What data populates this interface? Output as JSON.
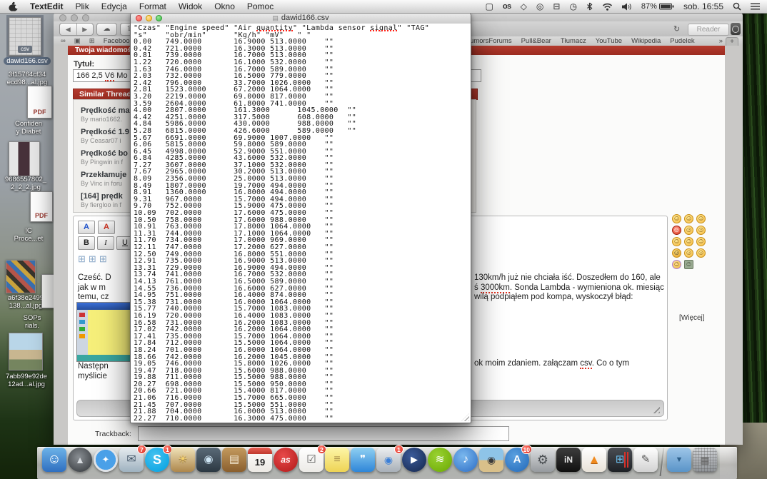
{
  "menu_bar": {
    "app_name": "TextEdit",
    "menus": [
      "Plik",
      "Edycja",
      "Format",
      "Widok",
      "Okno",
      "Pomoc"
    ],
    "status_icons": [
      {
        "name": "app-shape-icon",
        "glyph": "▢"
      },
      {
        "name": "lastfm-status-icon",
        "glyph": "os"
      },
      {
        "name": "dropbox-icon",
        "glyph": "◇"
      },
      {
        "name": "sync-alert-icon",
        "glyph": "◎"
      },
      {
        "name": "disk-icon",
        "glyph": "⊟"
      },
      {
        "name": "time-machine-icon",
        "glyph": "◷"
      }
    ],
    "battery": "87%",
    "clock": "sob. 16:55"
  },
  "desktop": {
    "icons": [
      {
        "name": "dawid166-csv",
        "kind": "csv",
        "badge": "csv",
        "selected": true,
        "lines": [
          "dawid166.csv"
        ],
        "thumb": [
          12,
          6,
          44,
          52
        ],
        "label": [
          0,
          62,
          76
        ]
      },
      {
        "name": "image-3f15764",
        "kind": "none",
        "selected": false,
        "lines": [
          "3f15764cf34",
          "ecd98...al.jpg"
        ],
        "thumb": null,
        "label": [
          0,
          81,
          76
        ]
      },
      {
        "name": "pdf-confiden",
        "kind": "pdf",
        "badge": "PDF",
        "selected": false,
        "lines": [
          "Confiden",
          "y Diabet"
        ],
        "thumb": [
          38,
          102,
          33,
          44
        ],
        "label": [
          4,
          150,
          72
        ]
      },
      {
        "name": "image-9686557802",
        "kind": "person",
        "selected": false,
        "lines": [
          "9686557802_",
          "2_2_2.jpg"
        ],
        "thumb": [
          12,
          180,
          42,
          47
        ],
        "label": [
          0,
          228,
          72
        ]
      },
      {
        "name": "pdf-ic-proce",
        "kind": "pdf",
        "badge": "PDF",
        "selected": false,
        "lines": [
          "IC",
          "Proce...et"
        ],
        "thumb": [
          42,
          250,
          30,
          41
        ],
        "label": [
          4,
          300,
          72
        ]
      },
      {
        "name": "image-a6f38e2499",
        "kind": "gta",
        "selected": false,
        "lines": [
          "a6f38e2499",
          "138...al.jpg"
        ],
        "thumb": [
          8,
          346,
          40,
          45
        ],
        "label": [
          0,
          394,
          72
        ]
      },
      {
        "name": "doc-sops",
        "kind": "sliver",
        "selected": false,
        "lines": [
          "SOPs",
          "rials."
        ],
        "thumb": [
          58,
          366,
          16,
          46
        ],
        "label": [
          16,
          422,
          58
        ]
      },
      {
        "name": "image-7abb99e92de",
        "kind": "photo",
        "selected": false,
        "lines": [
          "7abb99e92de",
          "12ad...al.jpg"
        ],
        "thumb": [
          12,
          448,
          46,
          51
        ],
        "label": [
          0,
          504,
          74
        ]
      }
    ]
  },
  "safari": {
    "reader_label": "Reader",
    "bookmarks_left": [
      "Facebook"
    ],
    "bookmarks_right": [
      "umorsForums",
      "Pull&Bear",
      "Tłumacz",
      "YouTube",
      "Wikipedia",
      "Pudelek"
    ],
    "chevron": "»",
    "new_tab": "+"
  },
  "forum": {
    "banner": "Twoja wiadomość",
    "title_label": "Tytuł:",
    "title_value": [
      {
        "t": "166 2,5 "
      },
      {
        "t": "V6",
        "mis": true
      },
      {
        "t": " Mo"
      }
    ],
    "similar_header": "Similar Threads",
    "threads": [
      {
        "title": "Prędkość ma",
        "by": "By mario1662."
      },
      {
        "title": "Prędkość 1.9",
        "by": "By Ceasar07 i"
      },
      {
        "title": "Prędkość bo",
        "by": "By Pingwin in f"
      },
      {
        "title": "Przekłamuje",
        "by": "By Vinc in foru"
      },
      {
        "title": "[164] prędk",
        "by": "By fiergloo in f"
      }
    ],
    "editor": {
      "font_btn": "A",
      "color_btn": "A",
      "bold": "B",
      "italic": "I",
      "underline": "U"
    },
    "msg_left": [
      "Cześć. D",
      "jak w m",
      "temu, cz"
    ],
    "msg_left2": [
      "Następn",
      "myślicie"
    ],
    "msg_right": [
      [
        {
          "t": "130km/h już nie chciała iść. Doszedłem do 160, ale"
        }
      ],
      [
        {
          "t": "ś "
        },
        {
          "t": "3000km",
          "mis": true
        },
        {
          "t": ". Sonda Lambda - wymieniona ok. miesiąc"
        }
      ],
      [
        {
          "t": "wilą podpiąłem pod kompa, wyskoczył błąd:"
        }
      ]
    ],
    "msg_right2": [
      [
        {
          "t": "ok moim zdaniem. załączam "
        },
        {
          "t": "csv",
          "mis": true
        },
        {
          "t": ". Co o tym"
        }
      ]
    ],
    "more_link": "[Więcej]",
    "trackback_label": "Trackback:"
  },
  "textedit": {
    "window_title": "dawid166.csv",
    "csv": {
      "header": [
        "\"Czas\"",
        "\"Engine speed\"",
        "\"Air quantity\"",
        "\"Lambda sensor signal\"",
        "\"TAG\""
      ],
      "units": [
        "\"s\"",
        "\"obr/min\"",
        "\"Kg/h\"",
        "\"mV\"",
        "\" \""
      ],
      "tag": "\"\"",
      "rows": [
        [
          "0.00",
          "749.0000",
          "16.9000",
          "513.0000"
        ],
        [
          "0.42",
          "721.0000",
          "16.3000",
          "513.0000"
        ],
        [
          "0.81",
          "739.0000",
          "16.7000",
          "513.0000"
        ],
        [
          "1.22",
          "720.0000",
          "16.1000",
          "532.0000"
        ],
        [
          "1.63",
          "746.0000",
          "16.7000",
          "589.0000"
        ],
        [
          "2.03",
          "732.0000",
          "16.5000",
          "779.0000"
        ],
        [
          "2.42",
          "796.0000",
          "33.7000",
          "1026.0000"
        ],
        [
          "2.81",
          "1523.0000",
          "67.2000",
          "1064.0000"
        ],
        [
          "3.20",
          "2219.0000",
          "69.0000",
          "817.0000"
        ],
        [
          "3.59",
          "2604.0000",
          "61.8000",
          "741.0000"
        ],
        [
          "4.00",
          "2807.0000",
          "161.3000",
          "1045.0000"
        ],
        [
          "4.42",
          "4251.0000",
          "317.5000",
          "608.0000"
        ],
        [
          "4.84",
          "5986.0000",
          "430.0000",
          "988.0000"
        ],
        [
          "5.28",
          "6815.0000",
          "426.6000",
          "589.0000"
        ],
        [
          "5.67",
          "6691.0000",
          "69.9000",
          "1007.0000"
        ],
        [
          "6.06",
          "5815.0000",
          "59.8000",
          "589.0000"
        ],
        [
          "6.45",
          "4998.0000",
          "52.9000",
          "551.0000"
        ],
        [
          "6.84",
          "4285.0000",
          "43.6000",
          "532.0000"
        ],
        [
          "7.27",
          "3607.0000",
          "37.1000",
          "532.0000"
        ],
        [
          "7.67",
          "2965.0000",
          "30.2000",
          "513.0000"
        ],
        [
          "8.09",
          "2356.0000",
          "25.0000",
          "513.0000"
        ],
        [
          "8.49",
          "1807.0000",
          "19.7000",
          "494.0000"
        ],
        [
          "8.91",
          "1360.0000",
          "16.8000",
          "494.0000"
        ],
        [
          "9.31",
          "967.0000",
          "15.7000",
          "494.0000"
        ],
        [
          "9.70",
          "752.0000",
          "15.9000",
          "475.0000"
        ],
        [
          "10.09",
          "702.0000",
          "17.6000",
          "475.0000"
        ],
        [
          "10.50",
          "758.0000",
          "17.6000",
          "988.0000"
        ],
        [
          "10.91",
          "763.0000",
          "17.8000",
          "1064.0000"
        ],
        [
          "11.31",
          "744.0000",
          "17.1000",
          "1064.0000"
        ],
        [
          "11.70",
          "734.0000",
          "17.0000",
          "969.0000"
        ],
        [
          "12.11",
          "747.0000",
          "17.2000",
          "627.0000"
        ],
        [
          "12.50",
          "749.0000",
          "16.8000",
          "551.0000"
        ],
        [
          "12.91",
          "735.0000",
          "16.9000",
          "513.0000"
        ],
        [
          "13.31",
          "729.0000",
          "16.9000",
          "494.0000"
        ],
        [
          "13.74",
          "741.0000",
          "16.7000",
          "532.0000"
        ],
        [
          "14.13",
          "761.0000",
          "16.5000",
          "589.0000"
        ],
        [
          "14.55",
          "736.0000",
          "16.6000",
          "627.0000"
        ],
        [
          "14.95",
          "751.0000",
          "16.4000",
          "874.0000"
        ],
        [
          "15.38",
          "731.0000",
          "16.0000",
          "1064.0000"
        ],
        [
          "15.77",
          "740.0000",
          "15.7000",
          "1083.0000"
        ],
        [
          "16.19",
          "720.0000",
          "16.4000",
          "1083.0000"
        ],
        [
          "16.58",
          "731.0000",
          "16.2000",
          "1083.0000"
        ],
        [
          "17.02",
          "742.0000",
          "16.2000",
          "1064.0000"
        ],
        [
          "17.41",
          "735.0000",
          "15.7000",
          "1064.0000"
        ],
        [
          "17.84",
          "712.0000",
          "15.5000",
          "1064.0000"
        ],
        [
          "18.24",
          "701.0000",
          "16.0000",
          "1064.0000"
        ],
        [
          "18.66",
          "742.0000",
          "16.2000",
          "1045.0000"
        ],
        [
          "19.05",
          "746.0000",
          "15.8000",
          "1026.0000"
        ],
        [
          "19.47",
          "718.0000",
          "15.6000",
          "988.0000"
        ],
        [
          "19.88",
          "711.0000",
          "15.5000",
          "988.0000"
        ],
        [
          "20.27",
          "698.0000",
          "15.5000",
          "950.0000"
        ],
        [
          "20.66",
          "721.0000",
          "15.4000",
          "817.0000"
        ],
        [
          "21.06",
          "716.0000",
          "15.7000",
          "665.0000"
        ],
        [
          "21.45",
          "707.0000",
          "15.5000",
          "551.0000"
        ],
        [
          "21.88",
          "704.0000",
          "16.0000",
          "513.0000"
        ],
        [
          "22.27",
          "710.0000",
          "16.3000",
          "475.0000"
        ]
      ]
    }
  },
  "emoticons": [
    {
      "k": "smile"
    },
    {
      "k": "grin"
    },
    {
      "k": "confused"
    },
    {
      "k": "mad"
    },
    {
      "k": "blush"
    },
    {
      "k": "laugh"
    },
    {
      "k": "happy"
    },
    {
      "k": "bigsmile"
    },
    {
      "k": "wink"
    },
    {
      "k": "cool"
    },
    {
      "k": "tongue"
    },
    {
      "k": "small"
    },
    {
      "k": "party"
    },
    {
      "k": "troll"
    }
  ],
  "dock": [
    {
      "id": "finder",
      "glyph": "☺"
    },
    {
      "id": "launchpad",
      "glyph": "▲"
    },
    {
      "id": "safari",
      "glyph": "✦"
    },
    {
      "id": "mail",
      "glyph": "✉",
      "badge": "7"
    },
    {
      "id": "skype",
      "glyph": "S",
      "badge": "1"
    },
    {
      "id": "iphoto",
      "glyph": "☀"
    },
    {
      "id": "photo-booth",
      "glyph": "◉"
    },
    {
      "id": "contacts",
      "glyph": "▤"
    },
    {
      "id": "calendar",
      "glyph": "19"
    },
    {
      "id": "lastfm",
      "glyph": "as"
    },
    {
      "id": "reminders",
      "glyph": "☑",
      "badge": "2"
    },
    {
      "id": "notes",
      "glyph": "≡"
    },
    {
      "id": "messages",
      "glyph": "❞"
    },
    {
      "id": "facetime",
      "glyph": "◉",
      "badge": "1"
    },
    {
      "id": "quicktime",
      "glyph": "▶"
    },
    {
      "id": "spotify",
      "glyph": "≋"
    },
    {
      "id": "itunes",
      "glyph": "♪"
    },
    {
      "id": "photos",
      "glyph": "◉"
    },
    {
      "id": "appstore",
      "glyph": "A",
      "badge": "10"
    },
    {
      "id": "sysprefs",
      "glyph": "⚙"
    },
    {
      "id": "independence",
      "glyph": "iN"
    },
    {
      "id": "vlc",
      "glyph": "▲"
    },
    {
      "id": "parallels",
      "glyph": "⊞"
    },
    {
      "id": "textedit",
      "glyph": "✎"
    },
    {
      "id": "divider"
    },
    {
      "id": "downloads",
      "glyph": "▼"
    },
    {
      "id": "trash",
      "glyph": "▦"
    }
  ]
}
